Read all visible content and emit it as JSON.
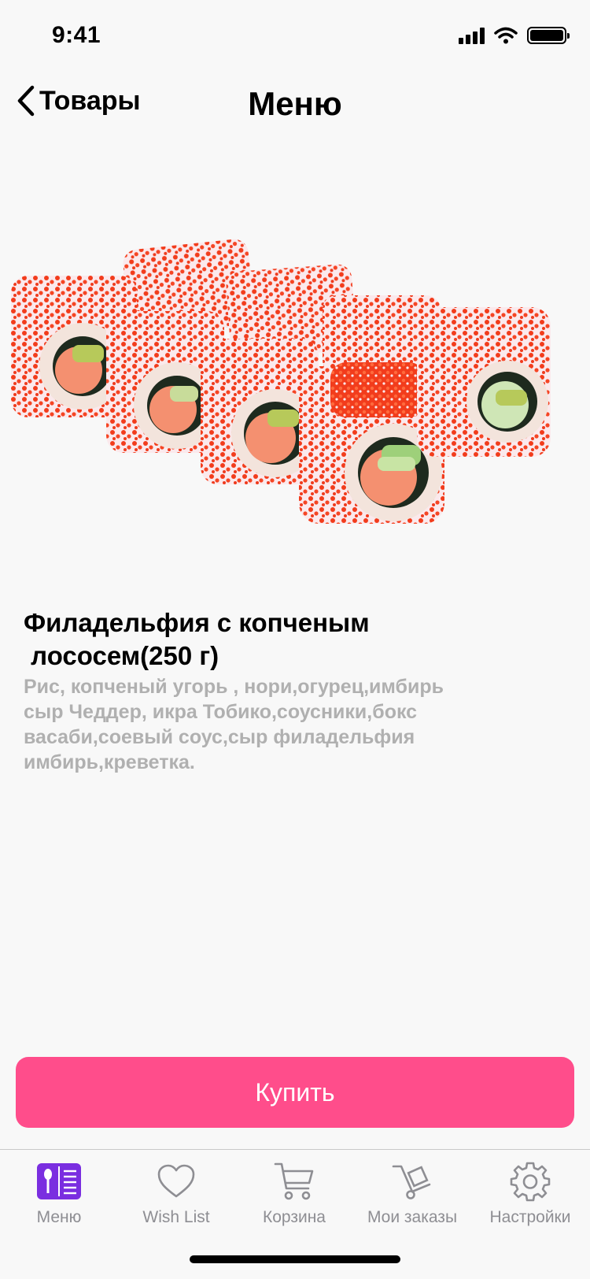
{
  "status_bar": {
    "time": "9:41",
    "icons": [
      "signal-icon",
      "wifi-icon",
      "battery-icon"
    ]
  },
  "nav": {
    "back_label": "Товары",
    "title": "Меню"
  },
  "product": {
    "name_line1": "Филадельфия с копченым",
    "name_line2": " лососем(250 г)",
    "description_lines": [
      "Рис, копченый угорь , нори,огурец,имбирь",
      "сыр Чеддер, икра Тобико,соусники,бокс",
      "васаби,соевый соус,сыр филадельфия",
      "имбирь,креветка."
    ]
  },
  "buy_label": "Купить",
  "tabs": [
    {
      "label": "Меню",
      "icon": "menu-book-icon",
      "active": true
    },
    {
      "label": "Wish List",
      "icon": "heart-icon",
      "active": false
    },
    {
      "label": "Корзина",
      "icon": "cart-icon",
      "active": false
    },
    {
      "label": "Мои заказы",
      "icon": "hand-truck-icon",
      "active": false
    },
    {
      "label": "Настройки",
      "icon": "gear-icon",
      "active": false
    }
  ],
  "colors": {
    "accent": "#ff4d8b",
    "tab_active": "#7a2ee0",
    "tab_inactive": "#8e8e93",
    "roe": "#f23c1c"
  }
}
